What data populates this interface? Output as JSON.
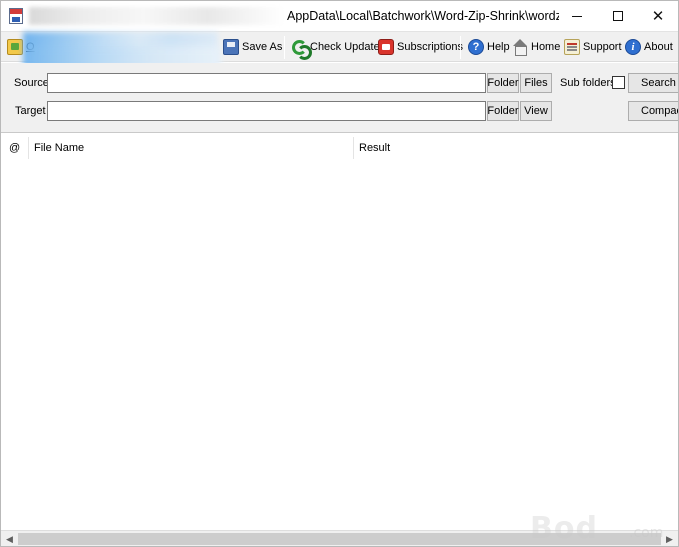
{
  "window": {
    "title": "AppData\\Local\\Batchwork\\Word-Zip-Shrink\\wordz..."
  },
  "toolbar": {
    "open_label": "O",
    "save_as_label": "Save As",
    "check_update_label": "Check Update",
    "subscriptions_label": "Subscriptions",
    "help_label": "Help",
    "home_label": "Home",
    "support_label": "Support",
    "about_label": "About"
  },
  "options": {
    "source_label": "Source",
    "source_value": "",
    "source_folder_button": "Folder",
    "source_files_button": "Files",
    "subfolders_label": "Sub folders",
    "subfolders_checked": false,
    "search_button": "Search",
    "target_label": "Target",
    "target_value": "",
    "target_folder_button": "Folder",
    "view_button": "View",
    "compact_button": "Compact"
  },
  "grid": {
    "columns": [
      "@",
      "File Name",
      "Result"
    ],
    "rows": []
  },
  "watermark": {
    "text": "Bod",
    "suffix": ".com"
  }
}
